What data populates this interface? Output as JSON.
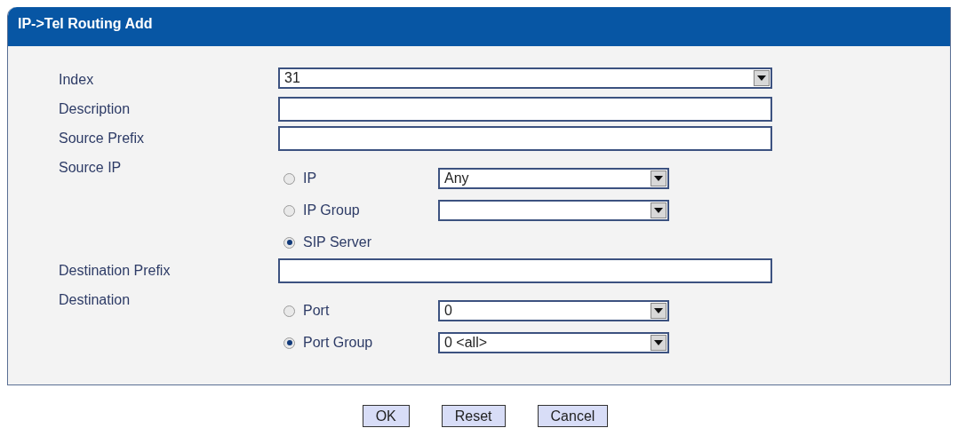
{
  "panel": {
    "title": "IP->Tel Routing Add"
  },
  "fields": [
    {
      "kind": "select",
      "label": "Index",
      "value": "31"
    },
    {
      "kind": "text",
      "label": "Description"
    },
    {
      "kind": "text",
      "label": "Source Prefix"
    },
    {
      "kind": "radio_group",
      "label": "Source IP",
      "options": [
        {
          "kind": "with_select",
          "label": "IP",
          "selected": false,
          "select": "Any"
        },
        {
          "kind": "with_select",
          "label": "IP Group",
          "selected": false
        },
        {
          "kind": "plain",
          "label": "SIP Server",
          "selected": true
        }
      ]
    },
    {
      "kind": "text",
      "label": "Destination Prefix"
    },
    {
      "kind": "radio_group",
      "label": "Destination",
      "options": [
        {
          "kind": "with_select",
          "label": "Port",
          "selected": false,
          "select": "0"
        },
        {
          "kind": "with_select",
          "label": "Port Group",
          "selected": true,
          "select": "0 <all>"
        }
      ]
    }
  ],
  "buttons": [
    "OK",
    "Reset",
    "Cancel"
  ]
}
